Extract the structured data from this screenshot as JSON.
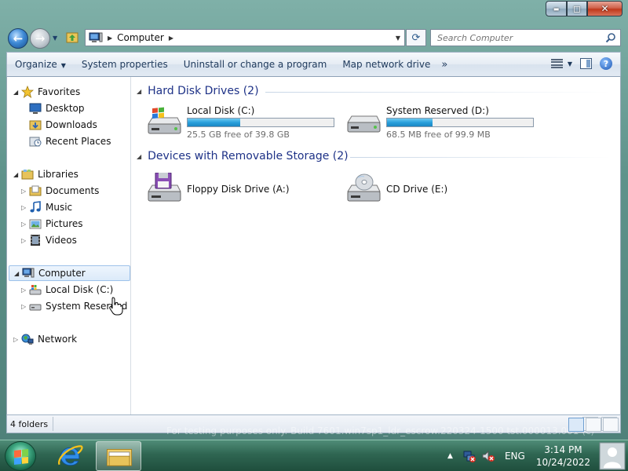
{
  "window": {
    "caption": {
      "minimize": "▬",
      "maximize": "◻",
      "close": "✕"
    }
  },
  "navigation": {
    "address_crumb": "Computer",
    "search_placeholder": "Search Computer"
  },
  "commandbar": {
    "organize": "Organize",
    "system_properties": "System properties",
    "uninstall": "Uninstall or change a program",
    "map_drive": "Map network drive",
    "more": "»"
  },
  "navpane": {
    "favorites": "Favorites",
    "desktop": "Desktop",
    "downloads": "Downloads",
    "recent_places": "Recent Places",
    "libraries": "Libraries",
    "documents": "Documents",
    "music": "Music",
    "pictures": "Pictures",
    "videos": "Videos",
    "computer": "Computer",
    "local_disk": "Local Disk (C:)",
    "system_reserved": "System Reserved (D:",
    "network": "Network"
  },
  "groups": {
    "hard_disks": "Hard Disk Drives (2)",
    "removable": "Devices with Removable Storage (2)"
  },
  "drives": [
    {
      "name": "Local Disk (C:)",
      "free": "25.5 GB free of 39.8 GB",
      "used_fraction": 0.36
    },
    {
      "name": "System Reserved (D:)",
      "free": "68.5 MB free of 99.9 MB",
      "used_fraction": 0.31
    }
  ],
  "devices": [
    {
      "name": "Floppy Disk Drive (A:)"
    },
    {
      "name": "CD Drive (E:)"
    }
  ],
  "statusbar": {
    "text": "4 folders"
  },
  "watermark": "For testing purposes only. Build 7601.win7sp1_ldr_escrow.220324-1500 tst.000013.001 (c)",
  "taskbar": {
    "language": "ENG",
    "time": "3:14 PM",
    "date": "10/24/2022"
  },
  "colors": {
    "accent": "#1e3287",
    "drive_bar": "#2aa0dc"
  }
}
